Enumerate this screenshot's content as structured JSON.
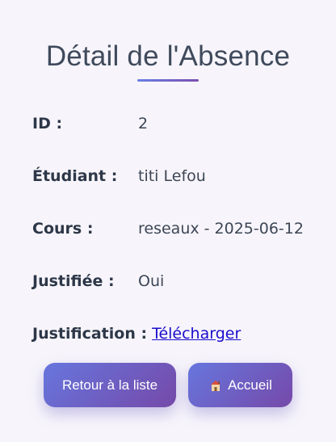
{
  "page": {
    "title": "Détail de l'Absence"
  },
  "details": {
    "id": {
      "label": "ID :",
      "value": "2"
    },
    "student": {
      "label": "Étudiant :",
      "value": "titi Lefou"
    },
    "course": {
      "label": "Cours :",
      "value": "reseaux - 2025-06-12"
    },
    "justified": {
      "label": "Justifiée :",
      "value": "Oui"
    },
    "justification": {
      "label": "Justification :",
      "link_text": "Télécharger"
    }
  },
  "buttons": {
    "back_label": "Retour à la liste",
    "home_label": "Accueil",
    "home_icon": "house-icon"
  },
  "colors": {
    "background": "#f7f5fb",
    "accent_start": "#6776dd",
    "accent_end": "#7549a9",
    "link": "#1a0dcc"
  }
}
